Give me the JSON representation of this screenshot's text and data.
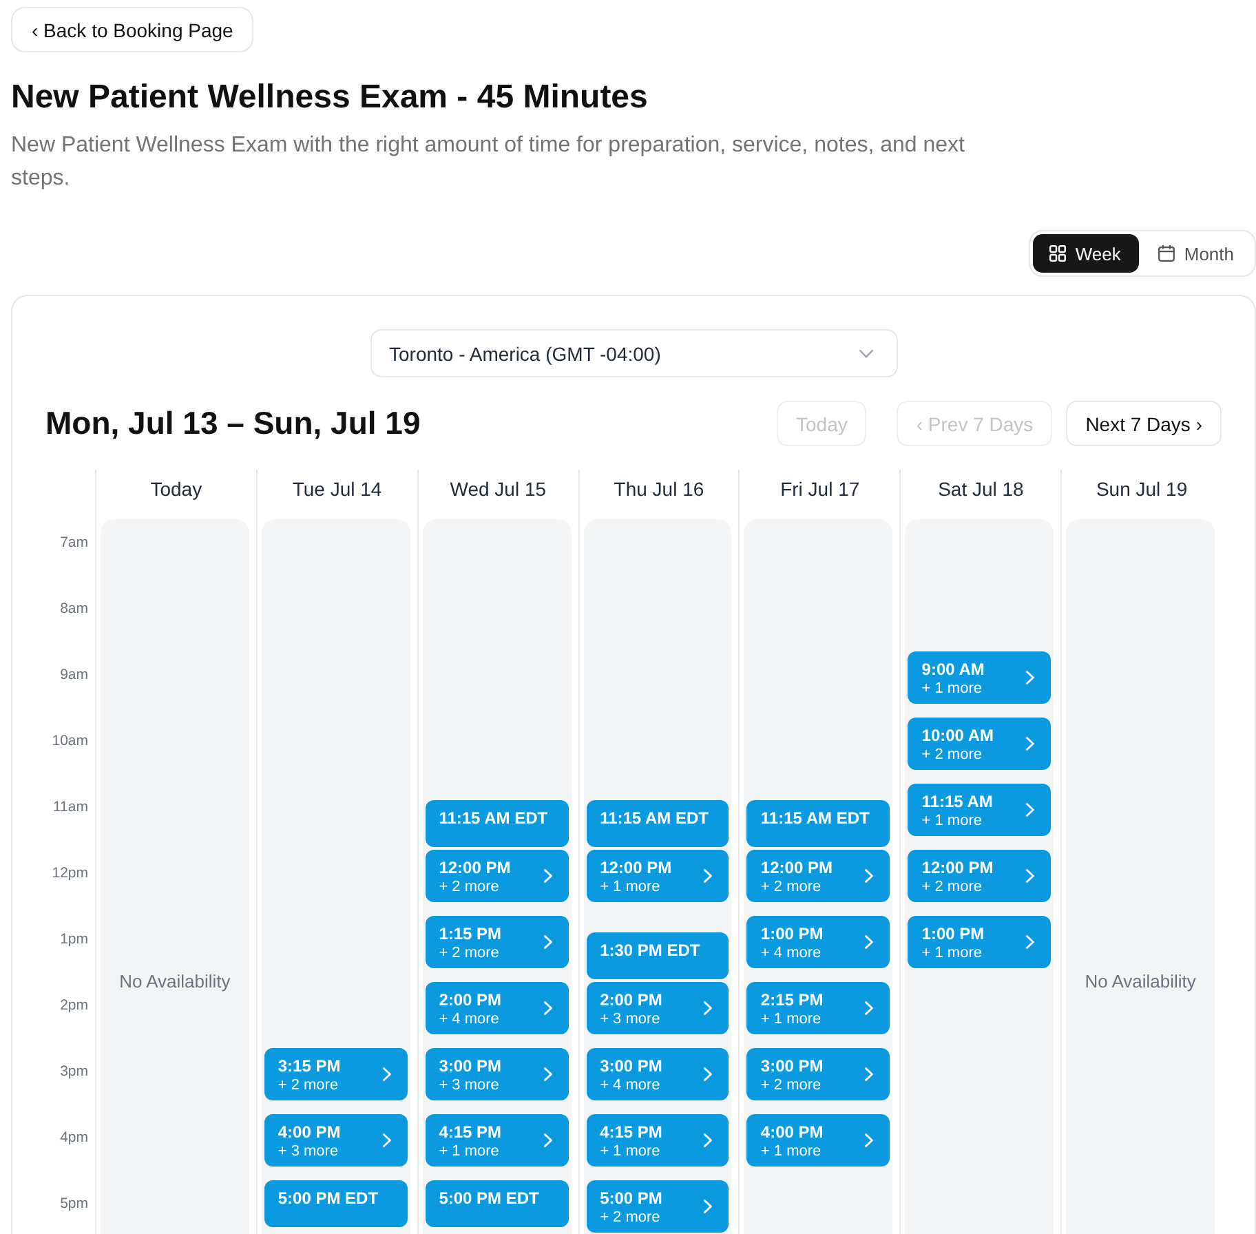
{
  "back_button": {
    "label": "‹ Back to Booking Page"
  },
  "title": "New Patient Wellness Exam - 45 Minutes",
  "description": "New Patient Wellness Exam with the right amount of time for preparation, service, notes, and next steps.",
  "view_tabs": [
    {
      "kind": "week",
      "label": "Week",
      "selected": true
    },
    {
      "kind": "month",
      "label": "Month",
      "selected": false
    }
  ],
  "calendar": {
    "timezone": {
      "value": "Toronto - America (GMT -04:00)"
    },
    "range_title": "Mon, Jul 13 – Sun, Jul 19",
    "nav_buttons": [
      {
        "label": "Today",
        "disabled": true
      },
      {
        "label": "‹ Prev 7 Days",
        "disabled": true
      },
      {
        "label": "Next 7 Days ›",
        "disabled": false
      }
    ],
    "hours": [
      "7am",
      "8am",
      "9am",
      "10am",
      "11am",
      "12pm",
      "1pm",
      "2pm",
      "3pm",
      "4pm",
      "5pm"
    ],
    "days": [
      {
        "label": "Today",
        "note": "No Availability"
      },
      {
        "label": "Tue Jul 14",
        "cells": [
          null,
          null,
          null,
          null,
          null,
          null,
          null,
          null,
          {
            "kind": "group",
            "time": "3:15 PM",
            "more": "+ 2 more"
          },
          {
            "kind": "group",
            "time": "4:00 PM",
            "more": "+ 3 more"
          },
          {
            "kind": "single",
            "time": "5:00 PM EDT"
          }
        ]
      },
      {
        "label": "Wed Jul 15",
        "cells": [
          null,
          null,
          null,
          null,
          {
            "kind": "single",
            "time": "11:15 AM EDT"
          },
          {
            "kind": "group",
            "time": "12:00 PM",
            "more": "+ 2 more"
          },
          {
            "kind": "group",
            "time": "1:15 PM",
            "more": "+ 2 more"
          },
          {
            "kind": "group",
            "time": "2:00 PM",
            "more": "+ 4 more"
          },
          {
            "kind": "group",
            "time": "3:00 PM",
            "more": "+ 3 more"
          },
          {
            "kind": "group",
            "time": "4:15 PM",
            "more": "+ 1 more"
          },
          {
            "kind": "single",
            "time": "5:00 PM EDT"
          }
        ]
      },
      {
        "label": "Thu Jul 16",
        "cells": [
          null,
          null,
          null,
          null,
          {
            "kind": "single",
            "time": "11:15 AM EDT"
          },
          {
            "kind": "group",
            "time": "12:00 PM",
            "more": "+ 1 more"
          },
          {
            "kind": "single",
            "time": "1:30 PM EDT"
          },
          {
            "kind": "group",
            "time": "2:00 PM",
            "more": "+ 3 more"
          },
          {
            "kind": "group",
            "time": "3:00 PM",
            "more": "+ 4 more"
          },
          {
            "kind": "group",
            "time": "4:15 PM",
            "more": "+ 1 more"
          },
          {
            "kind": "group",
            "time": "5:00 PM",
            "more": "+ 2 more"
          }
        ]
      },
      {
        "label": "Fri Jul 17",
        "cells": [
          null,
          null,
          null,
          null,
          {
            "kind": "single",
            "time": "11:15 AM EDT"
          },
          {
            "kind": "group",
            "time": "12:00 PM",
            "more": "+ 2 more"
          },
          {
            "kind": "group",
            "time": "1:00 PM",
            "more": "+ 4 more"
          },
          {
            "kind": "group",
            "time": "2:15 PM",
            "more": "+ 1 more"
          },
          {
            "kind": "group",
            "time": "3:00 PM",
            "more": "+ 2 more"
          },
          {
            "kind": "group",
            "time": "4:00 PM",
            "more": "+ 1 more"
          },
          null
        ]
      },
      {
        "label": "Sat Jul 18",
        "cells": [
          null,
          null,
          {
            "kind": "group",
            "time": "9:00 AM",
            "more": "+ 1 more"
          },
          {
            "kind": "group",
            "time": "10:00 AM",
            "more": "+ 2 more"
          },
          {
            "kind": "group",
            "time": "11:15 AM",
            "more": "+ 1 more"
          },
          {
            "kind": "group",
            "time": "12:00 PM",
            "more": "+ 2 more"
          },
          {
            "kind": "group",
            "time": "1:00 PM",
            "more": "+ 1 more"
          },
          null,
          null,
          null,
          null
        ]
      },
      {
        "label": "Sun Jul 19",
        "note": "No Availability"
      }
    ]
  }
}
